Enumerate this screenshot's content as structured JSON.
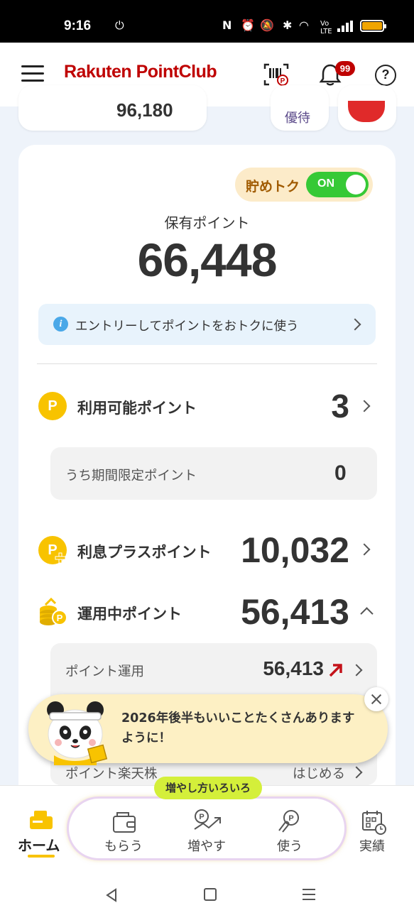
{
  "status_bar": {
    "time": "9:16"
  },
  "header": {
    "logo_text": "Rakuten PointClub",
    "notification_count": "99",
    "help_symbol": "?"
  },
  "peek_cards": {
    "points_value": "96,180",
    "benefit_label": "優待"
  },
  "saving": {
    "label": "貯めトク",
    "toggle_state": "ON"
  },
  "holding": {
    "label": "保有ポイント",
    "value": "66,448"
  },
  "entry_banner": {
    "text": "エントリーしてポイントをおトクに使う"
  },
  "available": {
    "label": "利用可能ポイント",
    "value": "3",
    "limited_label": "うち期間限定ポイント",
    "limited_value": "0"
  },
  "interest_plus": {
    "label": "利息プラスポイント",
    "value": "10,032"
  },
  "investing": {
    "label": "運用中ポイント",
    "value": "56,413",
    "sub_items": [
      {
        "label": "ポイント運用",
        "value": "56,413"
      },
      {
        "label": "ポイント楽天株",
        "value": "はじめる"
      }
    ]
  },
  "toast": {
    "message": "2026年後半もいいことたくさんありますように！"
  },
  "bottom_nav": {
    "home": "ホーム",
    "promo_tag": "増やし方いろいろ",
    "items": [
      "もらう",
      "増やす",
      "使う"
    ],
    "results": "実績"
  },
  "colors": {
    "brand_red": "#bf0000",
    "coin_yellow": "#f8c300",
    "toggle_green": "#36c936",
    "up_arrow": "#c4121a"
  }
}
